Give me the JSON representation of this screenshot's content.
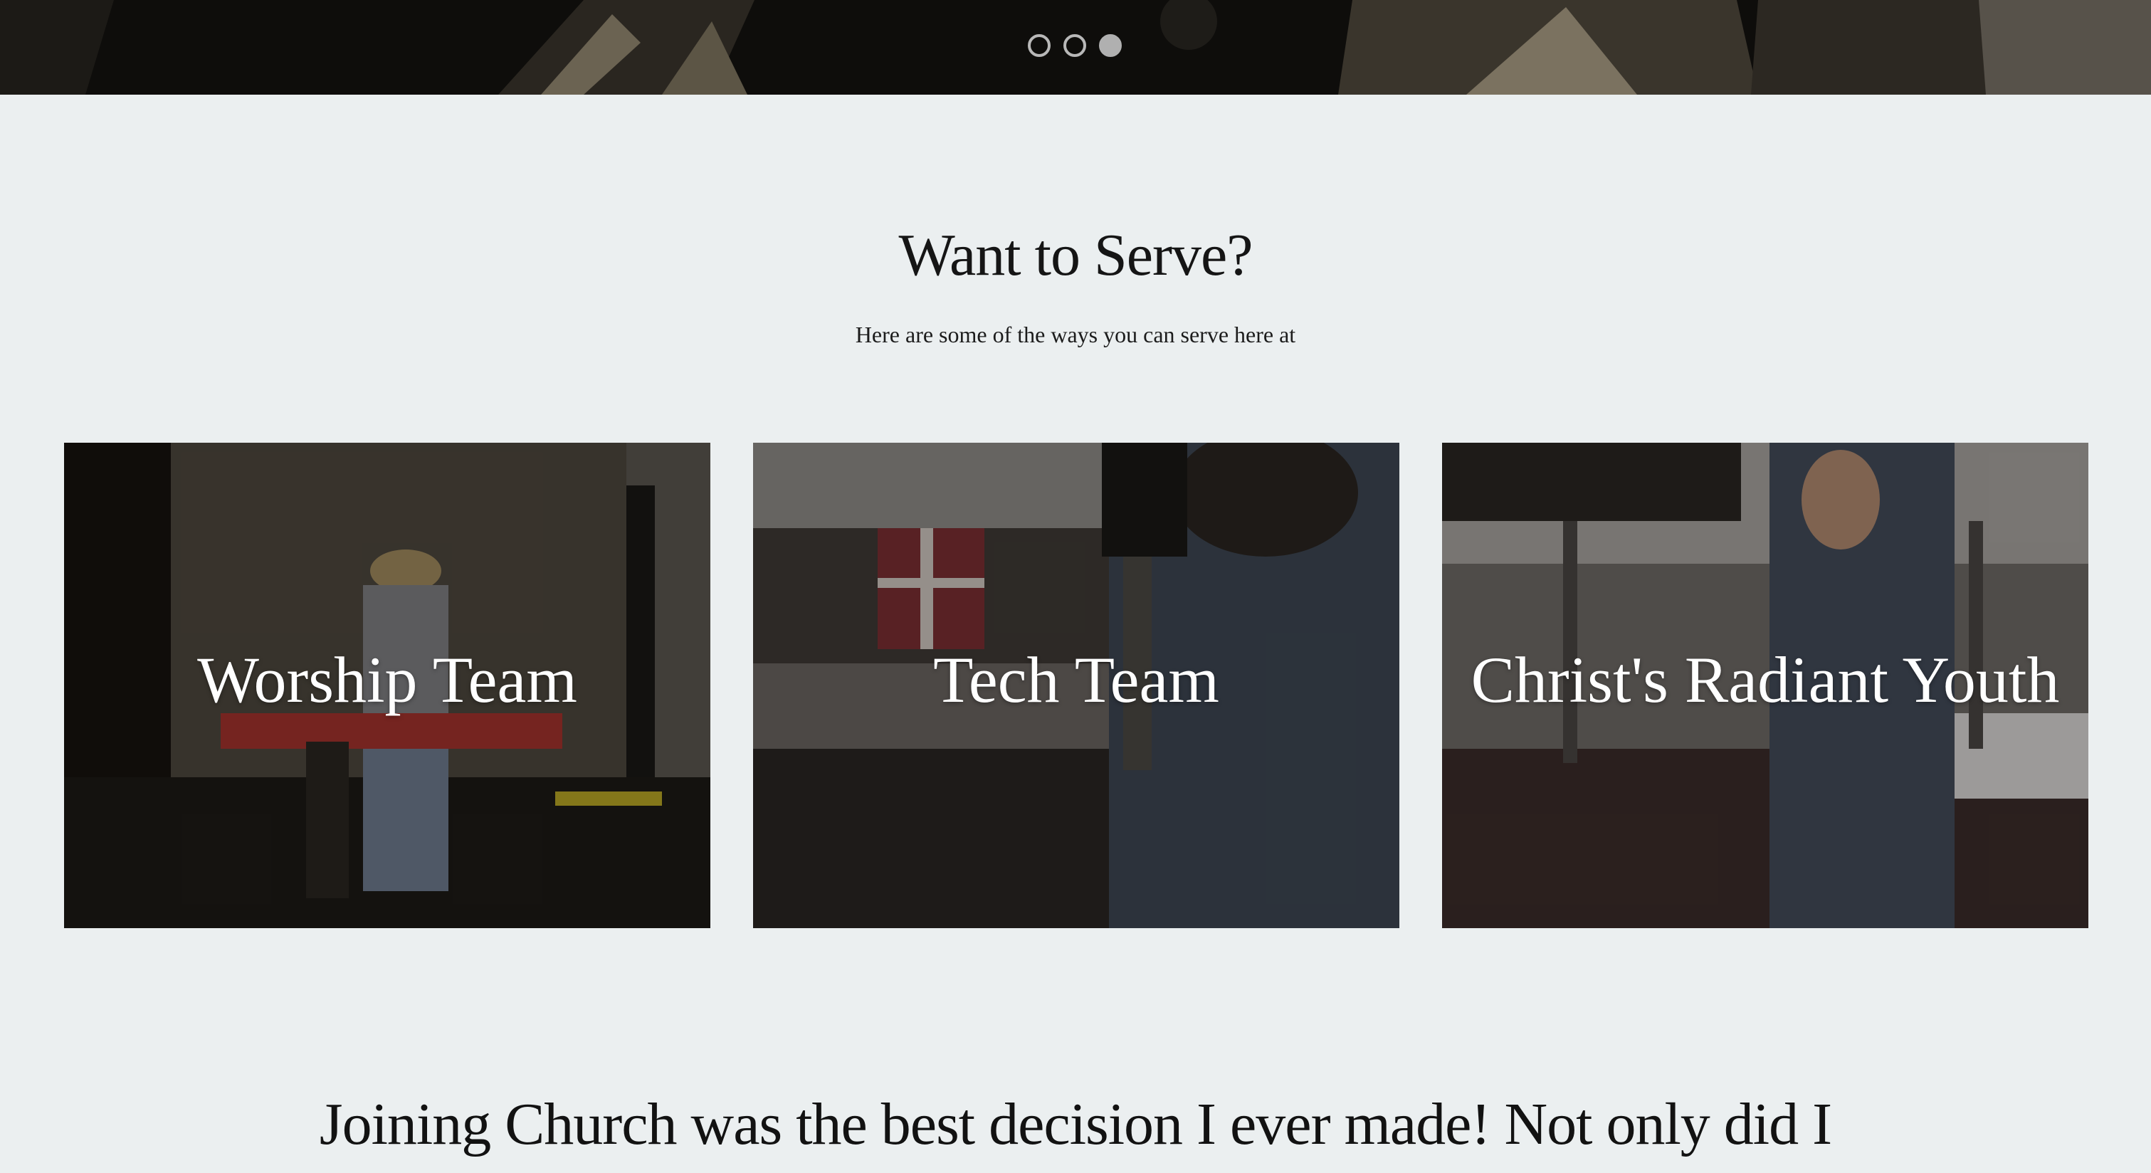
{
  "hero": {
    "carousel": {
      "slide_count": 3,
      "active_index": 2
    }
  },
  "serve": {
    "title": "Want to Serve?",
    "subtitle": "Here are some of the ways you can serve here at",
    "cards": [
      {
        "label": "Worship Team"
      },
      {
        "label": "Tech Team"
      },
      {
        "label": "Christ's Radiant Youth"
      }
    ]
  },
  "testimonial": {
    "text": "Joining Church was the best decision I ever made! Not only did I"
  },
  "colors": {
    "page_background": "#ebeff0",
    "hero_background": "#0d0c0a",
    "heading_text": "#151515",
    "card_text": "#ffffff"
  }
}
